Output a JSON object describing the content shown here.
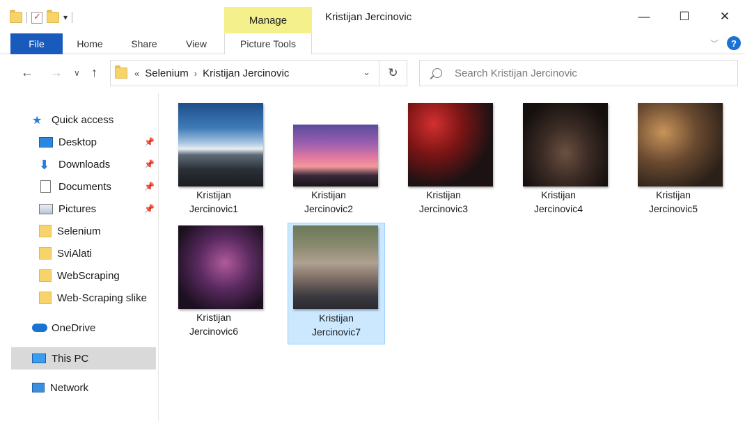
{
  "window": {
    "title": "Kristijan Jercinovic",
    "manage_label": "Manage",
    "minimize": "—",
    "maximize": "☐",
    "close": "✕"
  },
  "ribbon": {
    "tabs": [
      "File",
      "Home",
      "Share",
      "View",
      "Picture Tools"
    ],
    "help": "?"
  },
  "address": {
    "overflow": "«",
    "crumbs": [
      "Selenium",
      "Kristijan Jercinovic"
    ],
    "search_placeholder": "Search Kristijan Jercinovic"
  },
  "sidebar": {
    "items": [
      {
        "label": "Quick access",
        "icon": "quick-access-star-icon"
      },
      {
        "label": "Desktop",
        "icon": "desktop-icon",
        "pinned": true
      },
      {
        "label": "Downloads",
        "icon": "download-arrow-icon",
        "pinned": true
      },
      {
        "label": "Documents",
        "icon": "document-icon",
        "pinned": true
      },
      {
        "label": "Pictures",
        "icon": "pictures-icon",
        "pinned": true
      },
      {
        "label": "Selenium",
        "icon": "folder-icon"
      },
      {
        "label": "SviAlati",
        "icon": "folder-icon"
      },
      {
        "label": "WebScraping",
        "icon": "folder-icon"
      },
      {
        "label": "Web-Scraping slike",
        "icon": "folder-icon"
      },
      {
        "label": "OneDrive",
        "icon": "cloud-icon"
      },
      {
        "label": "This PC",
        "icon": "computer-icon",
        "selected": true
      },
      {
        "label": "Network",
        "icon": "network-icon"
      }
    ]
  },
  "files": [
    {
      "line1": "Kristijan",
      "line2": "Jercinovic1"
    },
    {
      "line1": "Kristijan",
      "line2": "Jercinovic2"
    },
    {
      "line1": "Kristijan",
      "line2": "Jercinovic3"
    },
    {
      "line1": "Kristijan",
      "line2": "Jercinovic4"
    },
    {
      "line1": "Kristijan",
      "line2": "Jercinovic5"
    },
    {
      "line1": "Kristijan",
      "line2": "Jercinovic6"
    },
    {
      "line1": "Kristijan",
      "line2": "Jercinovic7",
      "selected": true
    }
  ]
}
